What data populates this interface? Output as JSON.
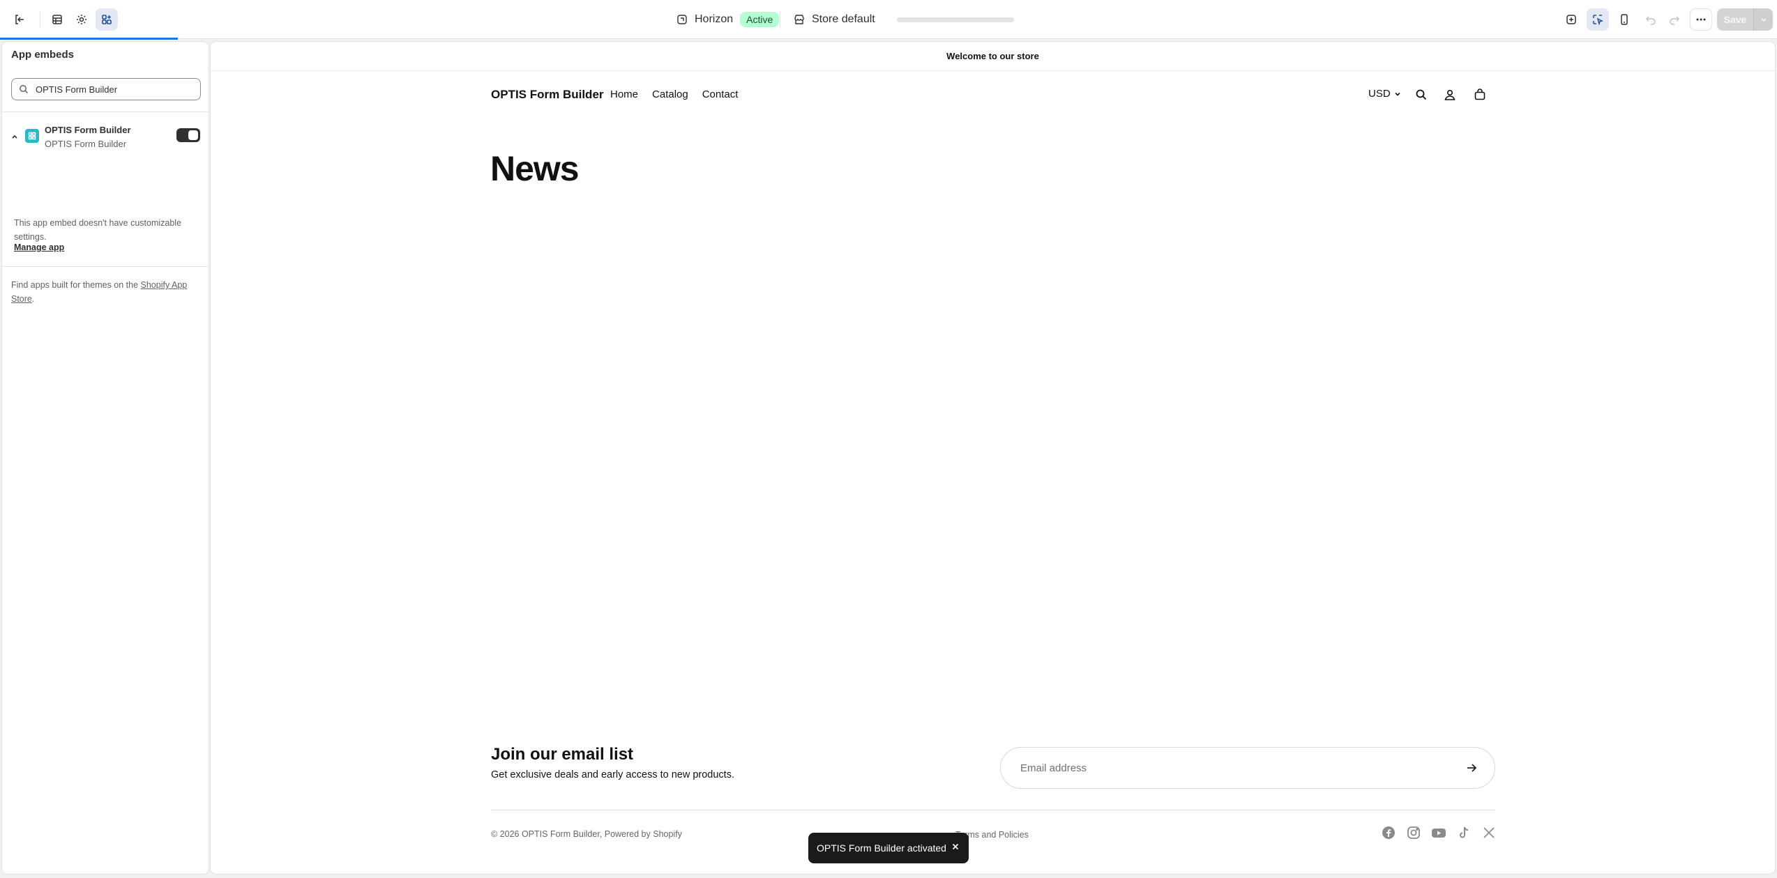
{
  "topbar": {
    "theme_name": "Horizon",
    "theme_status": "Active",
    "store_context": "Store default",
    "save_label": "Save"
  },
  "sidebar": {
    "title": "App embeds",
    "search_value": "OPTIS Form Builder",
    "app": {
      "name": "OPTIS Form Builder",
      "provider": "OPTIS Form Builder",
      "enabled": true,
      "note": "This app embed doesn't have customizable settings.",
      "manage_link": "Manage app"
    },
    "find_apps_prefix": "Find apps built for themes on the ",
    "find_apps_link": "Shopify App Store",
    "find_apps_suffix": "."
  },
  "preview": {
    "announcement": "Welcome to our store",
    "store_name": "OPTIS Form Builder",
    "nav": [
      "Home",
      "Catalog",
      "Contact"
    ],
    "currency": "USD",
    "page_title": "News",
    "newsletter": {
      "title": "Join our email list",
      "subtitle": "Get exclusive deals and early access to new products.",
      "placeholder": "Email address"
    },
    "copyright": "© 2026 OPTIS Form Builder, Powered by Shopify",
    "policies": "Terms and Policies",
    "socials": [
      "facebook-icon",
      "instagram-icon",
      "youtube-icon",
      "tiktok-icon",
      "x-icon"
    ]
  },
  "toast": {
    "message": "OPTIS Form Builder activated"
  },
  "colors": {
    "accent": "#1a73e8",
    "active_badge_bg": "#b4fed2",
    "active_badge_text": "#0c5132",
    "app_icon": "#2bb8c9",
    "toast_bg": "#1a1a1a"
  }
}
